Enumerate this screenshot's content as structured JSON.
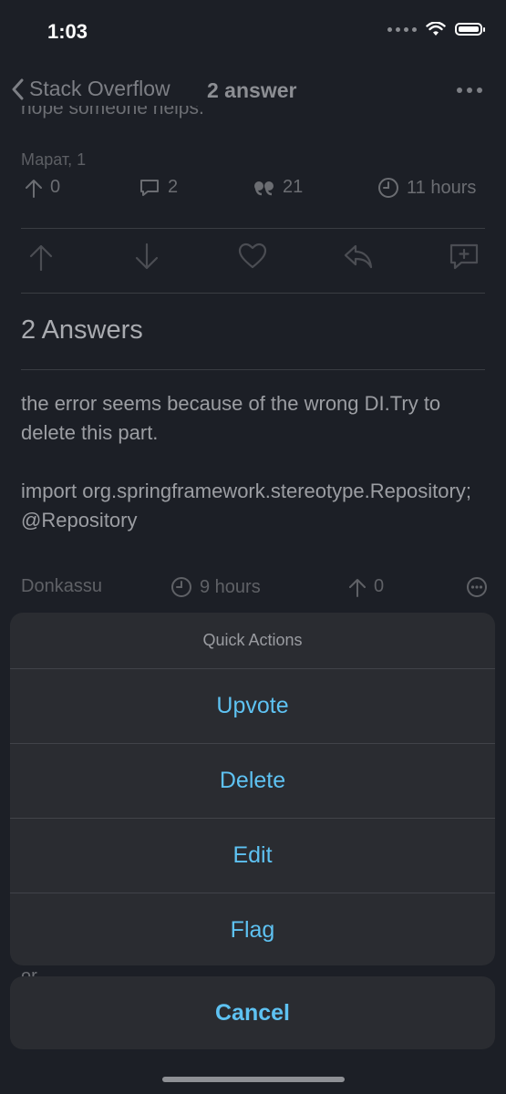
{
  "status": {
    "time": "1:03"
  },
  "nav": {
    "back_label": "Stack Overflow",
    "title": "2 answer"
  },
  "question": {
    "cut_text": "hope someone helps.",
    "author": "Марат, 1",
    "votes": "0",
    "comments": "2",
    "views": "21",
    "time": "11 hours"
  },
  "answers": {
    "heading": "2 Answers",
    "first": {
      "text_line1": "the error seems because of the wrong DI.Try to delete this part.",
      "text_line2": "import org.springframework.stereotype.Repository;@Repository",
      "author": "Donkassu",
      "time": "9 hours",
      "votes": "0"
    },
    "below_cut": "or"
  },
  "sheet": {
    "title": "Quick Actions",
    "items": [
      "Upvote",
      "Delete",
      "Edit",
      "Flag"
    ],
    "cancel": "Cancel"
  },
  "colors": {
    "accent": "#5ec2f2",
    "background": "#1c1f26",
    "sheet": "#2a2c31"
  }
}
